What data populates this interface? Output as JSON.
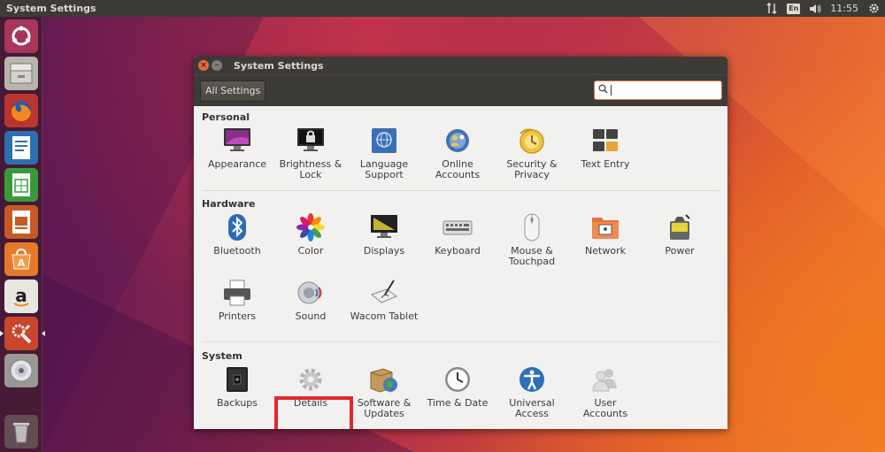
{
  "top_panel": {
    "app_title": "System Settings",
    "keyboard_layout": "En",
    "clock": "11:55"
  },
  "launcher": {
    "items": [
      {
        "icon": "ubuntu-dash-icon"
      },
      {
        "icon": "files-icon"
      },
      {
        "icon": "firefox-icon"
      },
      {
        "icon": "writer-icon"
      },
      {
        "icon": "calc-icon"
      },
      {
        "icon": "impress-icon"
      },
      {
        "icon": "software-center-icon"
      },
      {
        "icon": "amazon-icon"
      },
      {
        "icon": "system-settings-icon"
      },
      {
        "icon": "dvd-icon"
      },
      {
        "icon": "trash-icon"
      }
    ]
  },
  "window": {
    "title": "System Settings",
    "all_settings_label": "All Settings",
    "search": {
      "value": "",
      "icon": "search-icon"
    }
  },
  "sections": {
    "personal": {
      "title": "Personal",
      "items": [
        {
          "label": "Appearance",
          "icon": "appearance-icon"
        },
        {
          "label": "Brightness &\nLock",
          "icon": "brightness-lock-icon"
        },
        {
          "label": "Language\nSupport",
          "icon": "language-support-icon"
        },
        {
          "label": "Online\nAccounts",
          "icon": "online-accounts-icon"
        },
        {
          "label": "Security &\nPrivacy",
          "icon": "security-privacy-icon"
        },
        {
          "label": "Text Entry",
          "icon": "text-entry-icon"
        }
      ]
    },
    "hardware": {
      "title": "Hardware",
      "items": [
        {
          "label": "Bluetooth",
          "icon": "bluetooth-icon"
        },
        {
          "label": "Color",
          "icon": "color-icon"
        },
        {
          "label": "Displays",
          "icon": "displays-icon"
        },
        {
          "label": "Keyboard",
          "icon": "keyboard-icon"
        },
        {
          "label": "Mouse &\nTouchpad",
          "icon": "mouse-touchpad-icon"
        },
        {
          "label": "Network",
          "icon": "network-icon"
        },
        {
          "label": "Power",
          "icon": "power-icon"
        },
        {
          "label": "Printers",
          "icon": "printers-icon"
        },
        {
          "label": "Sound",
          "icon": "sound-icon"
        },
        {
          "label": "Wacom Tablet",
          "icon": "wacom-tablet-icon"
        }
      ]
    },
    "system": {
      "title": "System",
      "items": [
        {
          "label": "Backups",
          "icon": "backups-icon"
        },
        {
          "label": "Details",
          "icon": "details-gear-icon"
        },
        {
          "label": "Software &\nUpdates",
          "icon": "software-updates-icon"
        },
        {
          "label": "Time & Date",
          "icon": "time-date-icon"
        },
        {
          "label": "Universal\nAccess",
          "icon": "universal-access-icon"
        },
        {
          "label": "User\nAccounts",
          "icon": "user-accounts-icon"
        }
      ]
    }
  },
  "colors": {
    "accent": "#e0582e",
    "highlight_box": "#e0282b",
    "panel": "#3c3b37"
  }
}
